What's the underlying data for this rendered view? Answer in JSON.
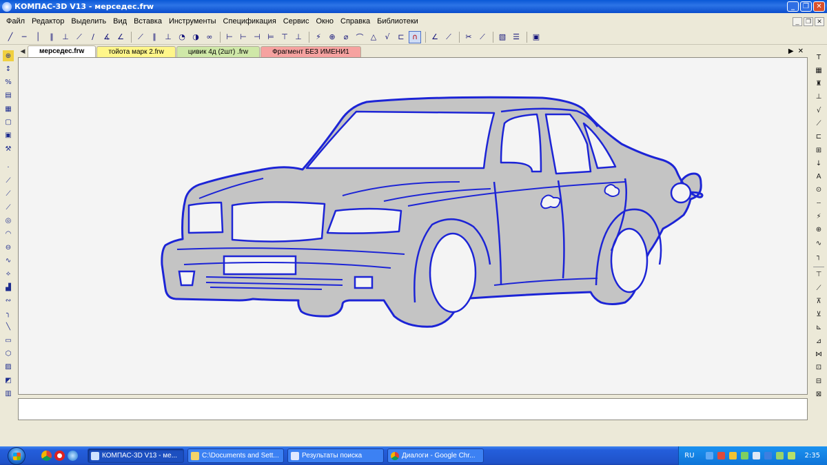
{
  "window": {
    "title": "КОМПАС-3D V13 - мерседес.frw",
    "min_label": "_",
    "max_label": "❐",
    "close_label": "✕"
  },
  "menu": {
    "items": [
      "Файл",
      "Редактор",
      "Выделить",
      "Вид",
      "Вставка",
      "Инструменты",
      "Спецификация",
      "Сервис",
      "Окно",
      "Справка",
      "Библиотеки"
    ]
  },
  "tabs": [
    {
      "label": "мерседес.frw",
      "color": "#ffffff"
    },
    {
      "label": "тойота марк 2.frw",
      "color": "#fff68a"
    },
    {
      "label": "цивик 4д (2шт) .frw",
      "color": "#cfe8a8"
    },
    {
      "label": "Фрагмент БЕЗ ИМЕНИ1",
      "color": "#f6a2a0"
    }
  ],
  "drawing": {
    "fill_color": "#c4c4c4",
    "stroke_color": "#1c24d6",
    "background": "#f4f4f4"
  },
  "taskbar": {
    "tasks": [
      {
        "label": "КОМПАС-3D V13 - ме...",
        "active": true,
        "icon": "kompas-icon"
      },
      {
        "label": "C:\\Documents and Sett...",
        "active": false,
        "icon": "folder-icon"
      },
      {
        "label": "Результаты поиска",
        "active": false,
        "icon": "search-results-icon"
      },
      {
        "label": "Диалоги - Google Chr...",
        "active": false,
        "icon": "chrome-icon"
      }
    ],
    "language": "RU",
    "clock": "2:35"
  }
}
